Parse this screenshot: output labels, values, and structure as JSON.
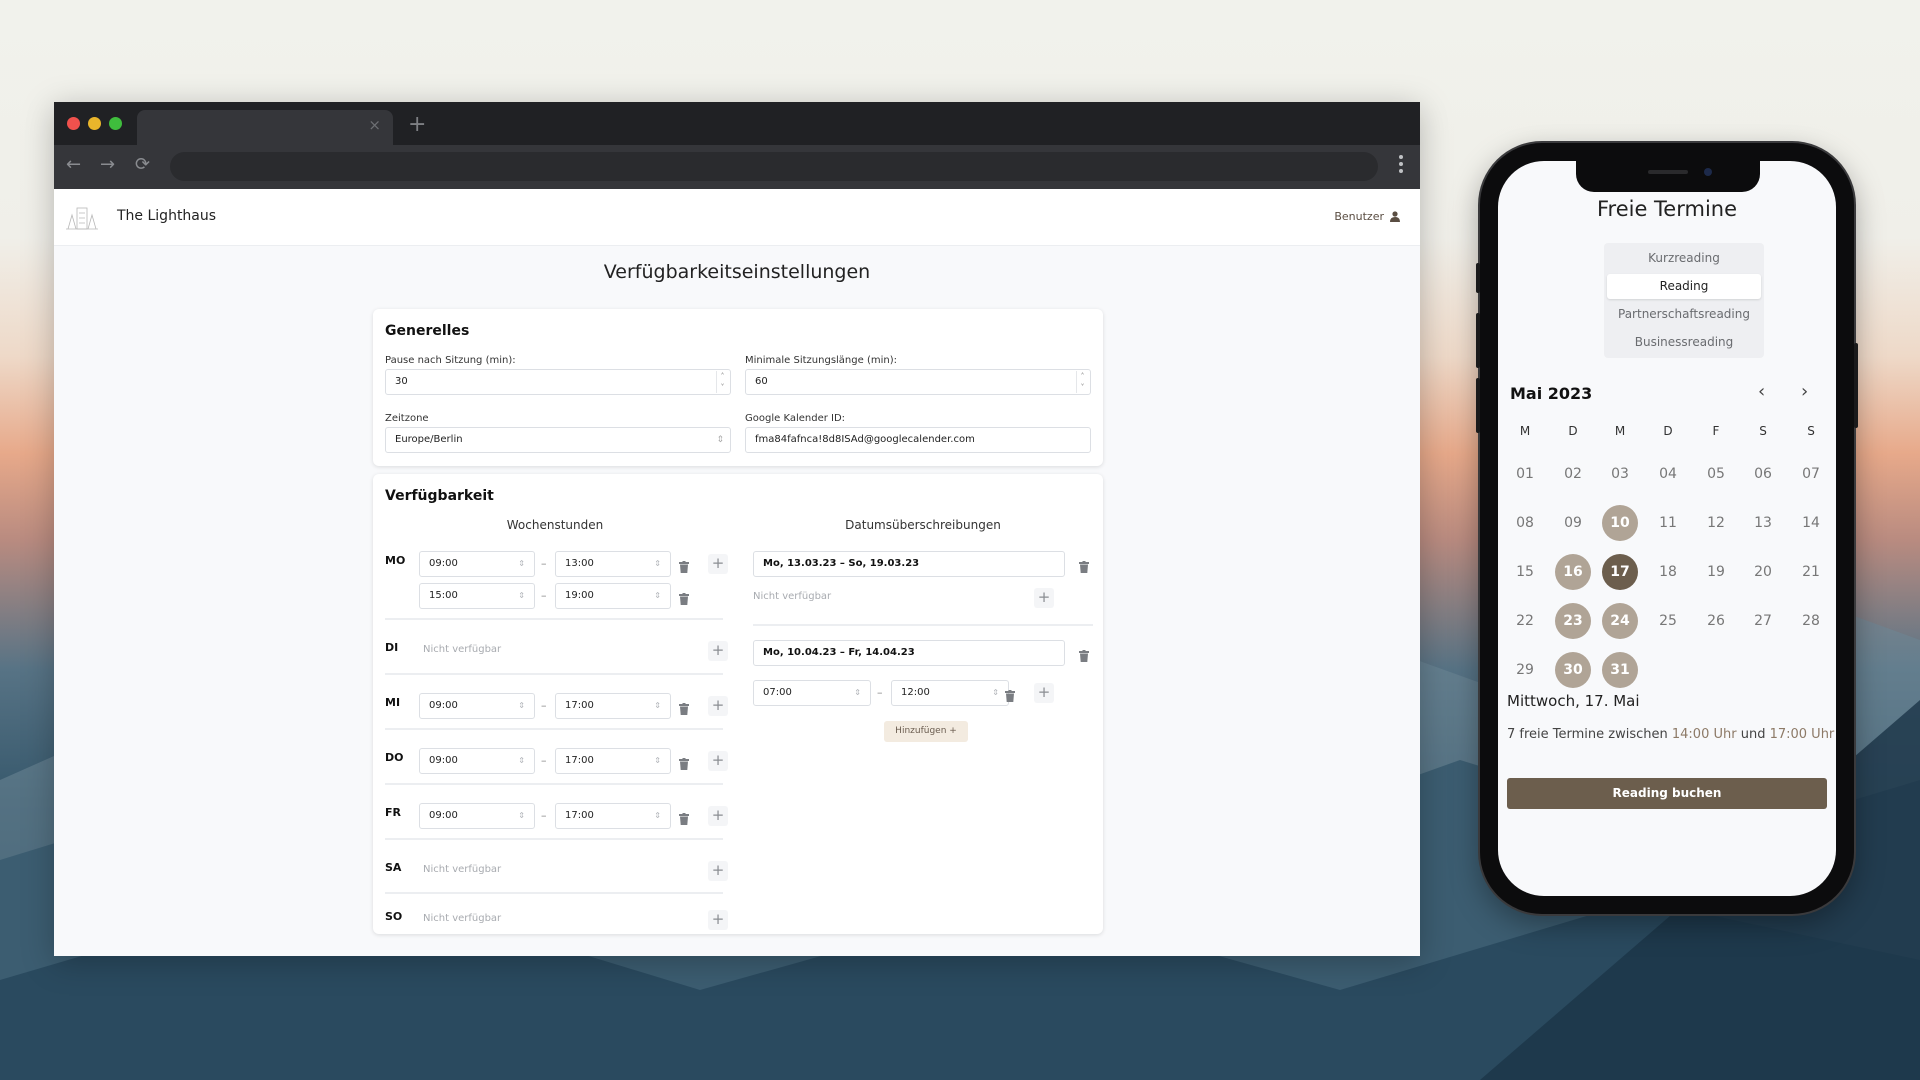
{
  "browser": {
    "tab_close": "×",
    "new_tab": "+",
    "nav": {
      "back": "←",
      "forward": "→",
      "reload": "⟳"
    }
  },
  "app": {
    "brand": "The Lighthaus",
    "user_label": "Benutzer",
    "page_title": "Verfügbarkeitseinstellungen"
  },
  "general": {
    "title": "Generelles",
    "pause_label": "Pause nach Sitzung (min):",
    "pause_value": "30",
    "min_len_label": "Minimale Sitzungslänge (min):",
    "min_len_value": "60",
    "timezone_label": "Zeitzone",
    "timezone_value": "Europe/Berlin",
    "gcal_label": "Google Kalender ID:",
    "gcal_value": "fma84fafnca!8d8ISAd@googlecalender.com",
    "spin_up": "˄",
    "spin_down": "˅",
    "select_arrows": "⇕"
  },
  "availability": {
    "title": "Verfügbarkeit",
    "weekly_header": "Wochenstunden",
    "overrides_header": "Datumsüberschreibungen",
    "dash": "–",
    "plus": "+",
    "arrows": "⇕",
    "days": [
      {
        "label": "MO",
        "slots": [
          {
            "from": "09:00",
            "to": "13:00"
          },
          {
            "from": "15:00",
            "to": "19:00"
          }
        ]
      },
      {
        "label": "DI",
        "unavailable": "Nicht verfügbar"
      },
      {
        "label": "MI",
        "slots": [
          {
            "from": "09:00",
            "to": "17:00"
          }
        ]
      },
      {
        "label": "DO",
        "slots": [
          {
            "from": "09:00",
            "to": "17:00"
          }
        ]
      },
      {
        "label": "FR",
        "slots": [
          {
            "from": "09:00",
            "to": "17:00"
          }
        ]
      },
      {
        "label": "SA",
        "unavailable": "Nicht verfügbar"
      },
      {
        "label": "SO",
        "unavailable": "Nicht verfügbar"
      }
    ],
    "overrides": [
      {
        "range": "Mo, 13.03.23 – So, 19.03.23",
        "unavailable": "Nicht verfügbar"
      },
      {
        "range": "Mo, 10.04.23 – Fr, 14.04.23",
        "slots": [
          {
            "from": "07:00",
            "to": "12:00"
          }
        ]
      }
    ],
    "add_label": "Hinzufügen +"
  },
  "phone": {
    "title": "Freie Termine",
    "session_types": [
      {
        "label": "Kurzreading",
        "active": false
      },
      {
        "label": "Reading",
        "active": true
      },
      {
        "label": "Partnerschaftsreading",
        "active": false
      },
      {
        "label": "Businessreading",
        "active": false
      }
    ],
    "month": "Mai 2023",
    "prev": "‹",
    "next": "›",
    "weekdays": [
      "M",
      "D",
      "M",
      "D",
      "F",
      "S",
      "S"
    ],
    "days": [
      [
        "01",
        "02",
        "03",
        "04",
        "05",
        "06",
        "07"
      ],
      [
        "08",
        "09",
        "10",
        "11",
        "12",
        "13",
        "14"
      ],
      [
        "15",
        "16",
        "17",
        "18",
        "19",
        "20",
        "21"
      ],
      [
        "22",
        "23",
        "24",
        "25",
        "26",
        "27",
        "28"
      ],
      [
        "29",
        "30",
        "31"
      ]
    ],
    "available_days": [
      "10",
      "16",
      "23",
      "24",
      "30",
      "31"
    ],
    "selected_day": "17",
    "selected_date_label": "Mittwoch, 17. Mai",
    "slots_text_1": "7 freie Termine zwischen ",
    "slots_from": "14:00 Uhr",
    "slots_text_2": " und ",
    "slots_to": "17:00 Uhr",
    "book_label": "Reading buchen"
  }
}
